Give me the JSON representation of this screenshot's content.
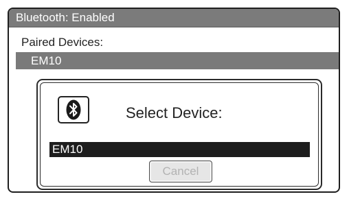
{
  "window": {
    "title": "Bluetooth: Enabled"
  },
  "paired": {
    "label": "Paired Devices:",
    "devices": [
      "EM10"
    ]
  },
  "dialog": {
    "icon": "bluetooth-icon",
    "title": "Select Device:",
    "devices": [
      "EM10"
    ],
    "cancel_label": "Cancel"
  },
  "colors": {
    "titlebar": "#7b7b7b",
    "paired_row": "#7a7a7a",
    "selected_row": "#1d1d1d",
    "button_disabled_text": "#b2b2b2"
  }
}
